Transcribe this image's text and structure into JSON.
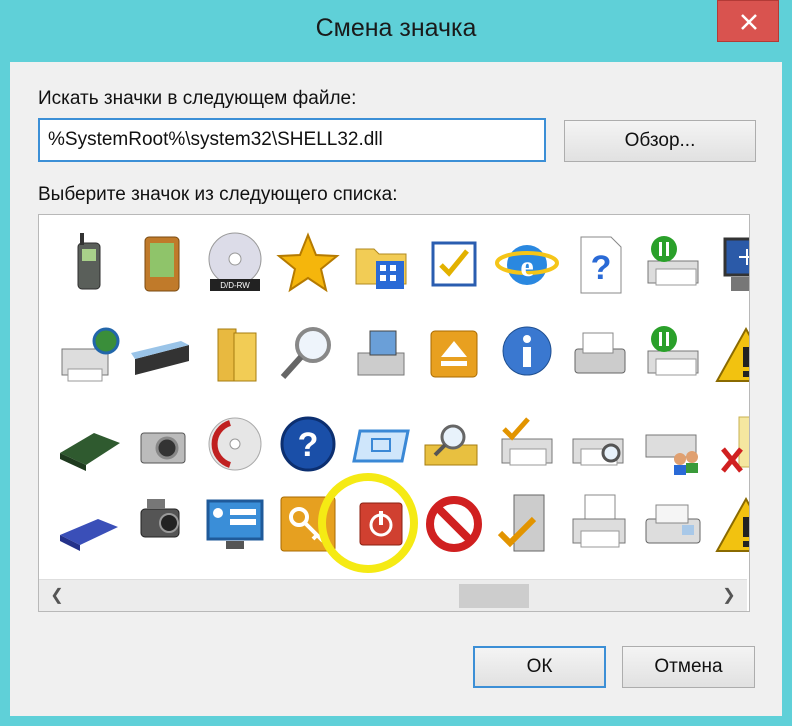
{
  "window": {
    "title": "Смена значка",
    "close_icon": "close-icon",
    "bg_color": "#5fd0d8",
    "accent_color": "#3c8fd6"
  },
  "file_section": {
    "label": "Искать значки в следующем файле:",
    "path_value": "%SystemRoot%\\system32\\SHELL32.dll",
    "browse_label": "Обзор..."
  },
  "list_section": {
    "label": "Выберите значок из следующего списка:",
    "icons": [
      [
        "mobile-phone-icon",
        "pda-icon",
        "dvd-rw-icon",
        "star-icon",
        "folder-apps-icon",
        "checklist-icon",
        "internet-explorer-icon",
        "help-document-icon",
        "printer-pause-icon",
        "computer-icon"
      ],
      [
        "network-printer-icon",
        "scanner-icon",
        "folder-icon",
        "magnifier-icon",
        "scanner-camera-icon",
        "eject-icon",
        "info-bubble-icon",
        "fax-icon",
        "printer-pause-icon",
        "warning-icon"
      ],
      [
        "drive-icon",
        "camera-icon",
        "disc-icon",
        "help-circle-icon",
        "screen-icon",
        "folder-search-icon",
        "printer-check-icon",
        "printer-search-icon",
        "printer-users-icon",
        "document-delete-icon"
      ],
      [
        "floppy-icon",
        "video-camera-icon",
        "network-screen-icon",
        "key-icon",
        "power-icon",
        "no-entry-icon",
        "server-check-icon",
        "printer-document-icon",
        "fax-machine-icon",
        "warning-icon"
      ]
    ],
    "selected_icon": "power-icon",
    "scroll_left_icon": "chevron-left-icon",
    "scroll_right_icon": "chevron-right-icon"
  },
  "buttons": {
    "ok_label": "ОК",
    "cancel_label": "Отмена"
  }
}
